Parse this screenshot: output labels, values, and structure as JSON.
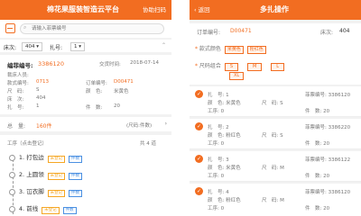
{
  "left": {
    "header": {
      "title": "棉花果服装智造云平台",
      "action": "协助扫码"
    },
    "search": {
      "placeholder": "请输入菲票编号"
    },
    "filters": {
      "bed_label": "床次:",
      "bed_value": "404",
      "bundle_label": "扎号:",
      "bundle_value": "1"
    },
    "ticket": {
      "number_label": "编菲编号:",
      "number_value": "3386120",
      "submit_label": "交货时间:",
      "submit_value": "2018-07-14",
      "cut_person_label": "裁床人员:",
      "style_label": "款式编号:",
      "style_value": "0713",
      "order_label": "订单编号:",
      "order_value": "D00471",
      "size_label": "尺　码:",
      "size_value": "S",
      "color_label": "颜　色:",
      "color_value": "米黄色",
      "bed_label": "床　次:",
      "bed_value": "404",
      "bundle_label": "扎　号:",
      "bundle_value": "1",
      "pieces_label": "件　数:",
      "pieces_value": "20"
    },
    "summary": {
      "total_label": "总　量:",
      "total_value": "160件",
      "unit_hint": "(尺码:件数)"
    },
    "process": {
      "header": "工序（点击登记）",
      "count": "共 4 道",
      "items": [
        {
          "name": "1. 打包边",
          "tag1": "未登记",
          "tag2": "件数"
        },
        {
          "name": "2. 上圆领",
          "tag1": "未登记",
          "tag2": "件数"
        },
        {
          "name": "3. 冚衣脚",
          "tag1": "未登记",
          "tag2": "件数"
        },
        {
          "name": "4. 前线",
          "tag1": "未登记",
          "tag2": "件数"
        }
      ]
    }
  },
  "right": {
    "header": {
      "back": "返回",
      "title": "多扎操作"
    },
    "order": {
      "label": "订单编号:",
      "value": "D00471",
      "bed_label": "床次:",
      "bed_value": "404"
    },
    "color_filter": {
      "label": "款式颜色",
      "options": [
        "米黄色",
        "粉红色"
      ]
    },
    "size_filter": {
      "label": "尺码组合",
      "options": [
        "S",
        "M",
        "L",
        "XL"
      ]
    },
    "bundles": [
      {
        "bundle_label": "扎　号:",
        "bundle_value": "1",
        "ticket_label": "菲票编号:",
        "ticket_value": "3386120",
        "color_label": "颜　色:",
        "color_value": "米黄色",
        "size_label": "尺　码:",
        "size_value": "S",
        "process_label": "工序:",
        "process_value": "0",
        "pieces_label": "件　数:",
        "pieces_value": "20"
      },
      {
        "bundle_label": "扎　号:",
        "bundle_value": "2",
        "ticket_label": "菲票编号:",
        "ticket_value": "3386220",
        "color_label": "颜　色:",
        "color_value": "粉红色",
        "size_label": "尺　码:",
        "size_value": "S",
        "process_label": "工序:",
        "process_value": "0",
        "pieces_label": "件　数:",
        "pieces_value": "20"
      },
      {
        "bundle_label": "扎　号:",
        "bundle_value": "3",
        "ticket_label": "菲票编号:",
        "ticket_value": "3386122",
        "color_label": "颜　色:",
        "color_value": "米黄色",
        "size_label": "尺　码:",
        "size_value": "M",
        "process_label": "工序:",
        "process_value": "0",
        "pieces_label": "件　数:",
        "pieces_value": "20"
      },
      {
        "bundle_label": "扎　号:",
        "bundle_value": "4",
        "ticket_label": "菲票编号:",
        "ticket_value": "3386120",
        "color_label": "颜　色:",
        "color_value": "粉红色",
        "size_label": "尺　码:",
        "size_value": "M",
        "process_label": "工序:",
        "process_value": "0",
        "pieces_label": "件　数:",
        "pieces_value": "20"
      }
    ]
  },
  "colors": {
    "accent": "#f26d21",
    "background": "#f2f2f2"
  }
}
